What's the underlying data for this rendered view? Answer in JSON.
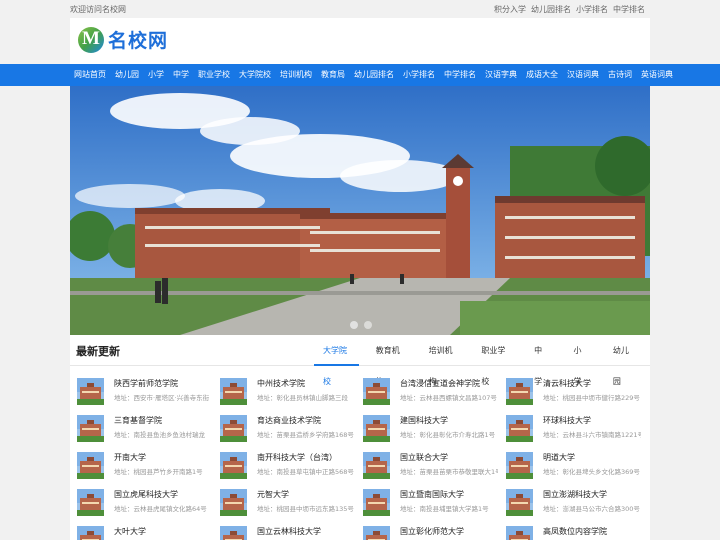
{
  "topbar": {
    "welcome": "欢迎访问名校网",
    "links": [
      "积分入学",
      "幼儿园排名",
      "小学排名",
      "中学排名"
    ]
  },
  "logo": {
    "mark": "M",
    "text": "名校网"
  },
  "nav": [
    "网站首页",
    "幼儿园",
    "小学",
    "中学",
    "职业学校",
    "大学院校",
    "培训机构",
    "教育局",
    "幼儿园排名",
    "小学排名",
    "中学排名",
    "汉语字典",
    "成语大全",
    "汉语词典",
    "古诗词",
    "英语词典"
  ],
  "panel": {
    "title": "最新更新",
    "tabs": [
      "大学院校",
      "教育机构",
      "培训机构",
      "职业学校",
      "中学",
      "小学",
      "幼儿园"
    ],
    "active_tab": "大学院校",
    "items": [
      {
        "name": "陕西学前师范学院",
        "addr": "地址：西安市·雁塔区·兴善寺东街"
      },
      {
        "name": "中州技术学院",
        "addr": "地址：彰化县员林镇山脚路三段"
      },
      {
        "name": "台湾浸信宣道会神学院",
        "addr": "地址：云林县西螺镇文昌路107号"
      },
      {
        "name": "清云科技大学",
        "addr": "地址：桃园县中坜市健行路229号"
      },
      {
        "name": "三育基督学院",
        "addr": "地址：南投县鱼池乡鱼池村瑞龙"
      },
      {
        "name": "育达商业技术学院",
        "addr": "地址：苗栗县造桥乡学府路168号"
      },
      {
        "name": "建国科技大学",
        "addr": "地址：彰化县彰化市介寿北路1号"
      },
      {
        "name": "环球科技大学",
        "addr": "地址：云林县斗六市镇南路1221号"
      },
      {
        "name": "开南大学",
        "addr": "地址：桃园县芦竹乡开南路1号"
      },
      {
        "name": "南开科技大学（台湾）",
        "addr": "地址：南投县草屯镇中正路568号"
      },
      {
        "name": "国立联合大学",
        "addr": "地址：苗栗县苗栗市恭敬里联大1号"
      },
      {
        "name": "明道大学",
        "addr": "地址：彰化县埤头乡文化路369号"
      },
      {
        "name": "国立虎尾科技大学",
        "addr": "地址：云林县虎尾镇文化路64号"
      },
      {
        "name": "元智大学",
        "addr": "地址：桃园县中坜市远东路135号"
      },
      {
        "name": "国立暨南国际大学",
        "addr": "地址：南投县埔里镇大学路1号"
      },
      {
        "name": "国立澎湖科技大学",
        "addr": "地址：澎湖县马公市六合路300号"
      },
      {
        "name": "大叶大学",
        "addr": ""
      },
      {
        "name": "国立云林科技大学",
        "addr": ""
      },
      {
        "name": "国立彰化师范大学",
        "addr": ""
      },
      {
        "name": "高凤数位内容学院",
        "addr": ""
      }
    ]
  },
  "banner": {
    "slides": 2,
    "active": 1
  },
  "colors": {
    "brand": "#1877e5",
    "topbar_bg": "#f1f1f1"
  }
}
